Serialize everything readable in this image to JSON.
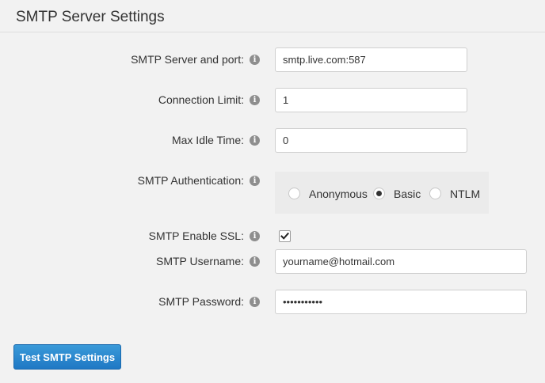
{
  "page": {
    "title": "SMTP Server Settings"
  },
  "info_glyph": "i",
  "fields": {
    "server": {
      "label": "SMTP Server and port:",
      "value": "smtp.live.com:587"
    },
    "connection_limit": {
      "label": "Connection Limit:",
      "value": "1"
    },
    "max_idle": {
      "label": "Max Idle Time:",
      "value": "0"
    },
    "auth": {
      "label": "SMTP Authentication:",
      "options": [
        "Anonymous",
        "Basic",
        "NTLM"
      ],
      "selected": "Basic"
    },
    "ssl": {
      "label": "SMTP Enable SSL:",
      "checked": true
    },
    "username": {
      "label": "SMTP Username:",
      "value": "yourname@hotmail.com"
    },
    "password": {
      "label": "SMTP Password:",
      "value": "•••••••••••"
    }
  },
  "actions": {
    "test_label": "Test SMTP Settings"
  },
  "colors": {
    "primary_button": "#1f78c4",
    "background": "#f2f2f2"
  }
}
